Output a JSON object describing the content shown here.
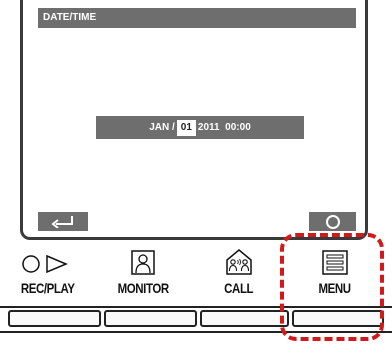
{
  "screen": {
    "title": "DATE/TIME",
    "date": {
      "month": "JAN /",
      "day": "01",
      "year_time": "2011  00:00"
    }
  },
  "soft_keys": [
    {
      "label": "REC/PLAY"
    },
    {
      "label": "MONITOR"
    },
    {
      "label": "CALL"
    },
    {
      "label": "MENU"
    }
  ],
  "colors": {
    "screen_bar": "#6e6e6e",
    "highlight": "#d21a1a"
  }
}
